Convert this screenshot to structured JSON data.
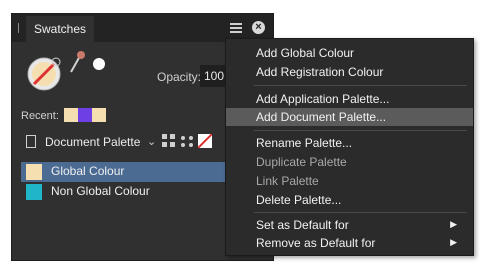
{
  "panel": {
    "tab_label": "Swatches",
    "opacity_label": "Opacity:",
    "opacity_value": "100",
    "recent_label": "Recent:",
    "recent_colors": [
      "#f5deb0",
      "#6f3fe6",
      "#f5deb0"
    ],
    "palette_name": "Document Palette",
    "swatches": [
      {
        "label": "Global Colour",
        "color": "#f5deb0",
        "selected": true
      },
      {
        "label": "Non Global Colour",
        "color": "#21b5c9",
        "selected": false
      }
    ]
  },
  "menu": {
    "items": [
      {
        "label": "Add Global Colour"
      },
      {
        "label": "Add Registration Colour"
      },
      {
        "label": "Add Application Palette..."
      },
      {
        "label": "Add Document Palette..."
      },
      {
        "label": "Rename Palette..."
      },
      {
        "label": "Duplicate Palette"
      },
      {
        "label": "Link Palette"
      },
      {
        "label": "Delete Palette..."
      },
      {
        "label": "Set as Default for"
      },
      {
        "label": "Remove as Default for"
      }
    ]
  }
}
